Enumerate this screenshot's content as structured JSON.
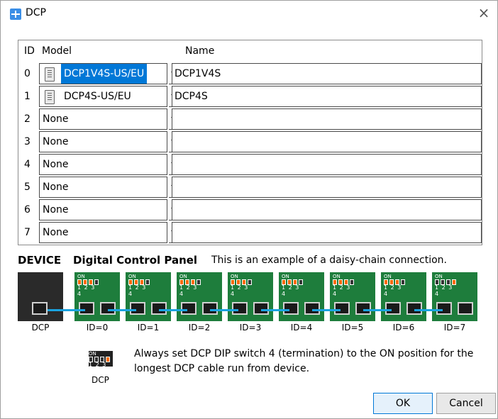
{
  "window": {
    "title": "DCP",
    "close_glyph": "×"
  },
  "grid": {
    "headers": {
      "id": "ID",
      "model": "Model",
      "name": "Name"
    },
    "rows": [
      {
        "id": "0",
        "model": "DCP1V4S-US/EU",
        "name": "DCP1V4S",
        "has_icon": true,
        "selected": true
      },
      {
        "id": "1",
        "model": "DCP4S-US/EU",
        "name": "DCP4S",
        "has_icon": true,
        "selected": false
      },
      {
        "id": "2",
        "model": "None",
        "name": ""
      },
      {
        "id": "3",
        "model": "None",
        "name": ""
      },
      {
        "id": "4",
        "model": "None",
        "name": ""
      },
      {
        "id": "5",
        "model": "None",
        "name": ""
      },
      {
        "id": "6",
        "model": "None",
        "name": ""
      },
      {
        "id": "7",
        "model": "None",
        "name": ""
      }
    ]
  },
  "diagram": {
    "device_label": "DEVICE",
    "panel_label": "Digital Control Panel",
    "caption": "This is an example of a daisy-chain connection.",
    "labels": [
      "DCP",
      "ID=0",
      "ID=1",
      "ID=2",
      "ID=3",
      "ID=4",
      "ID=5",
      "ID=6",
      "ID=7"
    ],
    "dip_on_text": "ON",
    "dip_numbers": "1 2 3 4",
    "cable_color": "#1aa3e0",
    "switch_on_color": "#ff6a00",
    "panel_color": "#1e7d3c"
  },
  "note": {
    "dip_label": "DCP",
    "text": "Always set DCP DIP switch 4 (termination) to the ON position for the longest DCP cable run from device."
  },
  "buttons": {
    "ok": "OK",
    "cancel": "Cancel"
  }
}
